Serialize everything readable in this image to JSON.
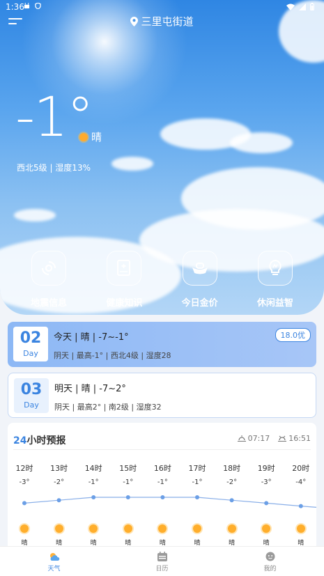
{
  "status_bar": {
    "time": "1:36"
  },
  "header": {
    "location": "三里屯街道"
  },
  "current": {
    "temperature": "-1°",
    "condition": "晴",
    "wind_humidity": "西北5级 | 湿度13%"
  },
  "features": [
    {
      "label": "地震信息",
      "icon": "earthquake-icon"
    },
    {
      "label": "健康知识",
      "icon": "health-book-icon"
    },
    {
      "label": "今日金价",
      "icon": "gold-ingot-icon"
    },
    {
      "label": "休闲益智",
      "icon": "lightbulb-icon"
    }
  ],
  "days": [
    {
      "date": "02",
      "date_label": "Day",
      "summary": "今天 | 晴 | -7~-1°",
      "detail": "阴天 | 最高-1° | 西北4级 | 湿度28",
      "aqi": "18.0优"
    },
    {
      "date": "03",
      "date_label": "Day",
      "summary": "明天 | 晴 | -7~2°",
      "detail": "阴天 | 最高2° | 南2级 | 湿度32"
    }
  ],
  "forecast": {
    "title_num": "24",
    "title_rest": "小时预报",
    "sunrise": "07:17",
    "sunset": "16:51",
    "hours": [
      {
        "label": "12时",
        "temp": "-3°",
        "temp_value": -3,
        "cond": "晴"
      },
      {
        "label": "13时",
        "temp": "-2°",
        "temp_value": -2,
        "cond": "晴"
      },
      {
        "label": "14时",
        "temp": "-1°",
        "temp_value": -1,
        "cond": "晴"
      },
      {
        "label": "15时",
        "temp": "-1°",
        "temp_value": -1,
        "cond": "晴"
      },
      {
        "label": "16时",
        "temp": "-1°",
        "temp_value": -1,
        "cond": "晴"
      },
      {
        "label": "17时",
        "temp": "-1°",
        "temp_value": -1,
        "cond": "晴"
      },
      {
        "label": "18时",
        "temp": "-2°",
        "temp_value": -2,
        "cond": "晴"
      },
      {
        "label": "19时",
        "temp": "-3°",
        "temp_value": -3,
        "cond": "晴"
      },
      {
        "label": "20时",
        "temp": "-4°",
        "temp_value": -4,
        "cond": "晴"
      }
    ]
  },
  "tabs": [
    {
      "label": "天气",
      "active": true
    },
    {
      "label": "日历",
      "active": false
    },
    {
      "label": "我的",
      "active": false
    }
  ],
  "colors": {
    "accent": "#3b84e0",
    "sun": "#ffae2c"
  }
}
